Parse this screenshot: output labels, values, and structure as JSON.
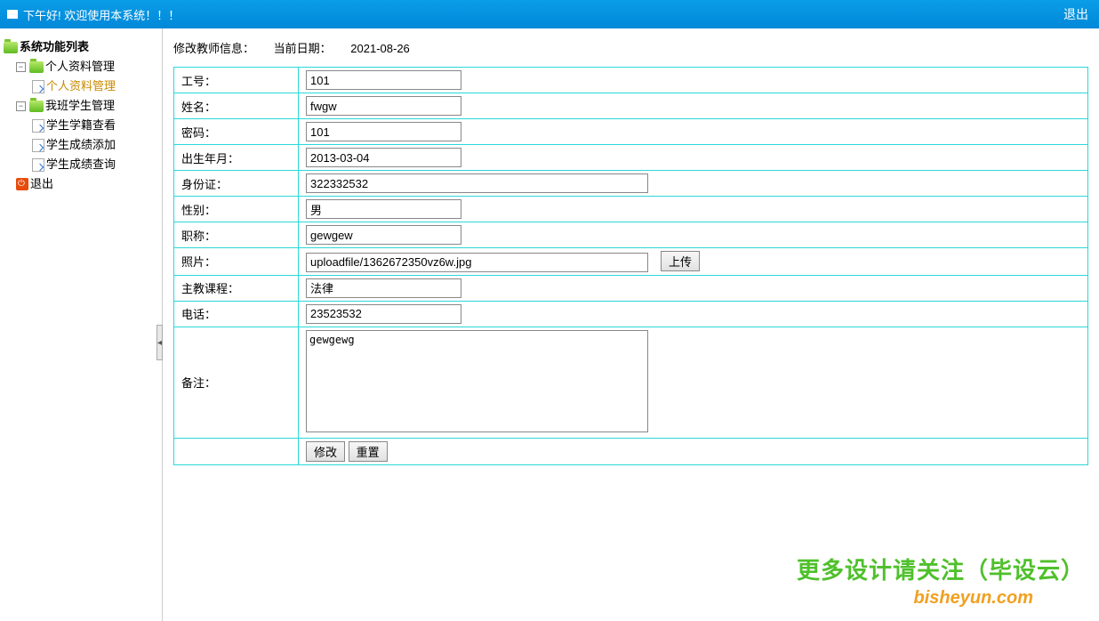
{
  "header": {
    "greeting": "下午好! 欢迎使用本系统！！！",
    "logout": "退出"
  },
  "sidebar": {
    "root": "系统功能列表",
    "groups": [
      {
        "label": "个人资料管理",
        "items": [
          {
            "label": "个人资料管理",
            "active": true
          }
        ]
      },
      {
        "label": "我班学生管理",
        "items": [
          {
            "label": "学生学籍查看"
          },
          {
            "label": "学生成绩添加"
          },
          {
            "label": "学生成绩查询"
          }
        ]
      }
    ],
    "exit": "退出"
  },
  "crumb": {
    "title": "修改教师信息：",
    "date_label": "当前日期：",
    "date_value": "2021-08-26"
  },
  "form": {
    "rows": [
      {
        "label": "工号：",
        "value": "101",
        "width": "mid"
      },
      {
        "label": "姓名：",
        "value": "fwgw",
        "width": "mid"
      },
      {
        "label": "密码：",
        "value": "101",
        "width": "mid"
      },
      {
        "label": "出生年月：",
        "value": "2013-03-04",
        "width": "mid"
      },
      {
        "label": "身份证：",
        "value": "322332532",
        "width": "long"
      },
      {
        "label": "性别：",
        "value": "男",
        "width": "mid"
      },
      {
        "label": "职称：",
        "value": "gewgew",
        "width": "mid"
      },
      {
        "label": "照片：",
        "value": "uploadfile/1362672350vz6w.jpg",
        "width": "long",
        "upload": true
      },
      {
        "label": "主教课程：",
        "value": "法律",
        "width": "mid"
      },
      {
        "label": "电话：",
        "value": "23523532",
        "width": "mid"
      }
    ],
    "remark_label": "备注：",
    "remark_value": "gewgewg",
    "upload_btn": "上传",
    "submit": "修改",
    "reset": "重置"
  },
  "watermark": {
    "line1": "更多设计请关注（毕设云）",
    "line2": "bisheyun.com"
  }
}
